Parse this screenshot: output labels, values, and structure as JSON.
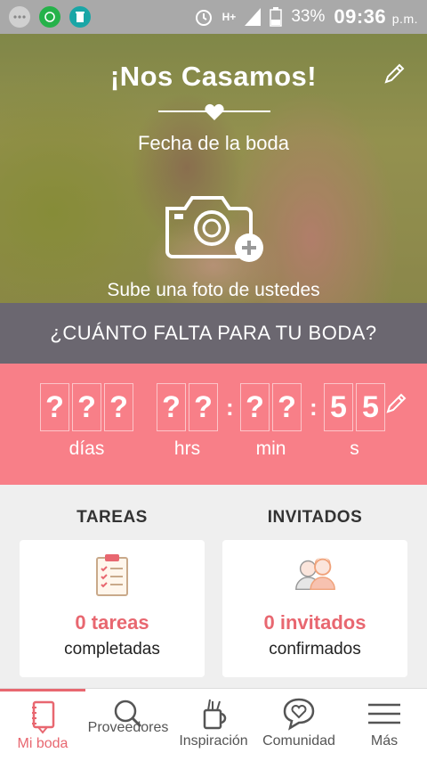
{
  "status_bar": {
    "battery": "33%",
    "time": "09:36",
    "ampm": "p.m.",
    "network": "H+"
  },
  "hero": {
    "title": "¡Nos Casamos!",
    "date_label": "Fecha de la boda",
    "upload_label": "Sube una foto de ustedes"
  },
  "question": "¿CUÁNTO FALTA PARA TU BODA?",
  "countdown": {
    "days": [
      "?",
      "?",
      "?"
    ],
    "hours": [
      "?",
      "?"
    ],
    "minutes": [
      "?",
      "?"
    ],
    "seconds": [
      "5",
      "5"
    ],
    "labels": {
      "days": "días",
      "hours": "hrs",
      "minutes": "min",
      "seconds": "s"
    }
  },
  "cards": {
    "tasks": {
      "heading": "TAREAS",
      "count": "0 tareas",
      "sub": "completadas"
    },
    "guests": {
      "heading": "INVITADOS",
      "count": "0 invitados",
      "sub": "confirmados"
    }
  },
  "nav": {
    "items": [
      {
        "label": "Mi boda",
        "icon": "notebook-icon"
      },
      {
        "label": "Proveedores",
        "icon": "search-icon"
      },
      {
        "label": "Inspiración",
        "icon": "inspiration-icon"
      },
      {
        "label": "Comunidad",
        "icon": "chat-heart-icon"
      },
      {
        "label": "Más",
        "icon": "menu-icon"
      }
    ]
  },
  "colors": {
    "accent": "#e86770",
    "countdown_bg": "#f87f88",
    "question_bg": "#6b6770"
  }
}
